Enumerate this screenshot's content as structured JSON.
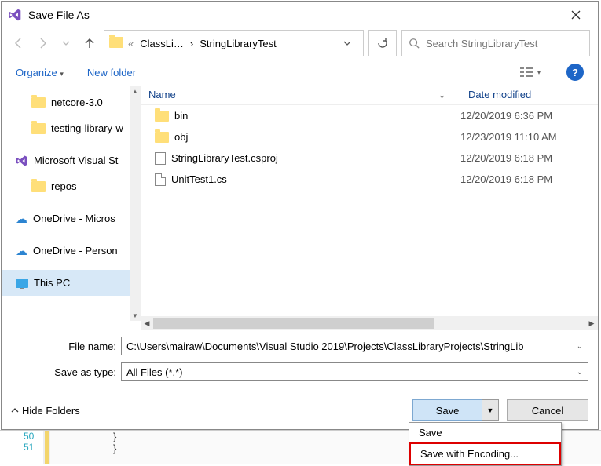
{
  "title": "Save File As",
  "nav": {
    "back_enabled": false,
    "forward_enabled": false,
    "up_enabled": true,
    "breadcrumb": [
      "ClassLi…",
      "StringLibraryTest"
    ],
    "search_placeholder": "Search StringLibraryTest"
  },
  "toolbar": {
    "organize": "Organize",
    "new_folder": "New folder",
    "help": "?"
  },
  "sidebar": {
    "items": [
      {
        "label": "netcore-3.0",
        "kind": "folder"
      },
      {
        "label": "testing-library-w",
        "kind": "folder"
      },
      {
        "label": "Microsoft Visual St",
        "kind": "vs"
      },
      {
        "label": "repos",
        "kind": "folder"
      },
      {
        "label": "OneDrive - Micros",
        "kind": "cloud"
      },
      {
        "label": "OneDrive - Person",
        "kind": "cloud"
      },
      {
        "label": "This PC",
        "kind": "pc",
        "selected": true
      }
    ]
  },
  "filelist": {
    "headers": {
      "name": "Name",
      "date": "Date modified"
    },
    "rows": [
      {
        "name": "bin",
        "kind": "folder",
        "date": "12/20/2019 6:36 PM"
      },
      {
        "name": "obj",
        "kind": "folder",
        "date": "12/23/2019 11:10 AM"
      },
      {
        "name": "StringLibraryTest.csproj",
        "kind": "csproj",
        "date": "12/20/2019 6:18 PM"
      },
      {
        "name": "UnitTest1.cs",
        "kind": "cs",
        "date": "12/20/2019 6:18 PM"
      }
    ]
  },
  "fields": {
    "filename_label": "File name:",
    "filename_value": "C:\\Users\\mairaw\\Documents\\Visual Studio 2019\\Projects\\ClassLibraryProjects\\StringLib",
    "saveas_label": "Save as type:",
    "saveas_value": "All Files (*.*)"
  },
  "buttons": {
    "hide_folders": "Hide Folders",
    "save": "Save",
    "cancel": "Cancel"
  },
  "dropdown": {
    "items": [
      "Save",
      "Save with Encoding..."
    ]
  },
  "editor": {
    "line1": "50",
    "line2": "51",
    "brace1": "}",
    "brace2": "}"
  }
}
